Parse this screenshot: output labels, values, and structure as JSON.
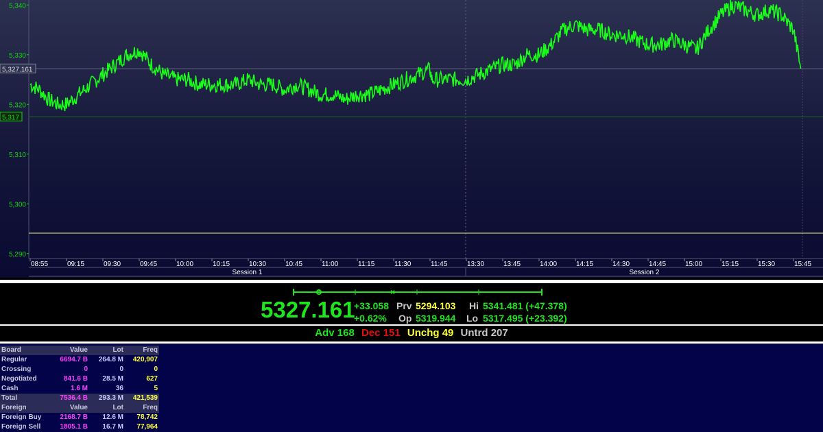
{
  "chart_data": {
    "type": "line",
    "ylim": [
      5289,
      5341
    ],
    "y_ticks": [
      "5,290",
      "5,300",
      "5,310",
      "5,320",
      "5,330",
      "5,340"
    ],
    "y_tick_values": [
      5290,
      5300,
      5310,
      5320,
      5330,
      5340
    ],
    "x_tick_labels": [
      "08:55",
      "09:15",
      "09:30",
      "09:45",
      "10:00",
      "10:15",
      "10:30",
      "10:45",
      "11:00",
      "11:15",
      "11:30",
      "11:45",
      "13:30",
      "13:45",
      "14:00",
      "14:15",
      "14:30",
      "14:45",
      "15:00",
      "15:15",
      "15:30",
      "15:45"
    ],
    "sessions": [
      "Session 1",
      "Session 2"
    ],
    "current_label": "5,327.161",
    "current_value": 5327.161,
    "low_label": "5,317",
    "low_value": 5317.495,
    "reference_value": 5294.1,
    "series": [
      {
        "x": [
          "08:55",
          "09:00",
          "09:05",
          "09:10",
          "09:15",
          "09:20",
          "09:25",
          "09:30",
          "09:35",
          "09:40",
          "09:45",
          "09:50",
          "09:55",
          "10:00",
          "10:05",
          "10:10",
          "10:15",
          "10:20",
          "10:25",
          "10:30",
          "10:35",
          "10:40",
          "10:45",
          "10:50",
          "10:55",
          "11:00",
          "11:05",
          "11:10",
          "11:15",
          "11:20",
          "11:25",
          "11:30",
          "11:35",
          "11:40",
          "11:45",
          "11:50",
          "13:30",
          "13:35",
          "13:40",
          "13:45",
          "13:50",
          "13:55",
          "14:00",
          "14:05",
          "14:10",
          "14:15",
          "14:20",
          "14:25",
          "14:30",
          "14:35",
          "14:40",
          "14:45",
          "14:50",
          "14:55",
          "15:00",
          "15:05",
          "15:10",
          "15:15",
          "15:20",
          "15:25",
          "15:30",
          "15:35",
          "15:40",
          "15:45",
          "15:48"
        ],
        "values": [
          5324,
          5323,
          5321,
          5320,
          5320,
          5322,
          5324,
          5326,
          5328,
          5330,
          5331,
          5328,
          5326,
          5325,
          5325,
          5324,
          5324,
          5324,
          5324,
          5325,
          5324,
          5324,
          5323,
          5324,
          5323,
          5322,
          5322,
          5321,
          5322,
          5322,
          5323,
          5324,
          5325,
          5326,
          5327,
          5325,
          5325,
          5326,
          5327,
          5328,
          5328,
          5330,
          5330,
          5332,
          5335,
          5336,
          5335,
          5335,
          5334,
          5334,
          5333,
          5332,
          5332,
          5333,
          5332,
          5331,
          5335,
          5338,
          5340,
          5339,
          5338,
          5339,
          5338,
          5335,
          5327.161
        ]
      }
    ]
  },
  "ticker": {
    "last": "5327.161",
    "change": "+33.058",
    "change_pct": "+0.62%",
    "prv_label": "Prv",
    "prv_value": "5294.103",
    "op_label": "Op",
    "op_value": "5319.944",
    "hi_label": "Hi",
    "hi_value": "5341.481 (+47.378)",
    "lo_label": "Lo",
    "lo_value": "5317.495 (+23.392)"
  },
  "breadth": {
    "adv": "Adv 168",
    "dec": "Dec 151",
    "unchg": "Unchg 49",
    "untrd": "Untrd 207"
  },
  "board_table": {
    "headers": [
      "Board",
      "Value",
      "Lot",
      "Freq"
    ],
    "rows": [
      {
        "name": "Regular",
        "value": "6694.7 B",
        "lot": "264.8 M",
        "freq": "420,907"
      },
      {
        "name": "Crossing",
        "value": "0",
        "lot": "0",
        "freq": "0"
      },
      {
        "name": "Negotiated",
        "value": "841.6 B",
        "lot": "28.5 M",
        "freq": "627"
      },
      {
        "name": "Cash",
        "value": "1.6 M",
        "lot": "36",
        "freq": "5"
      }
    ],
    "total": {
      "name": "Total",
      "value": "7536.4 B",
      "lot": "293.3 M",
      "freq": "421,539"
    }
  },
  "foreign_table": {
    "headers": [
      "Foreign",
      "Value",
      "Lot",
      "Freq"
    ],
    "rows": [
      {
        "name": "Foreign Buy",
        "value": "2168.7 B",
        "lot": "12.6 M",
        "freq": "78,742"
      },
      {
        "name": "Foreign Sell",
        "value": "1805.1 B",
        "lot": "16.7 M",
        "freq": "77,964"
      }
    ]
  },
  "colors": {
    "line": "#19ff19",
    "axis_text": "#18d418",
    "accent_yellow": "#ffff3c",
    "dec_red": "#e01010",
    "value_magenta": "#ff40ff"
  }
}
